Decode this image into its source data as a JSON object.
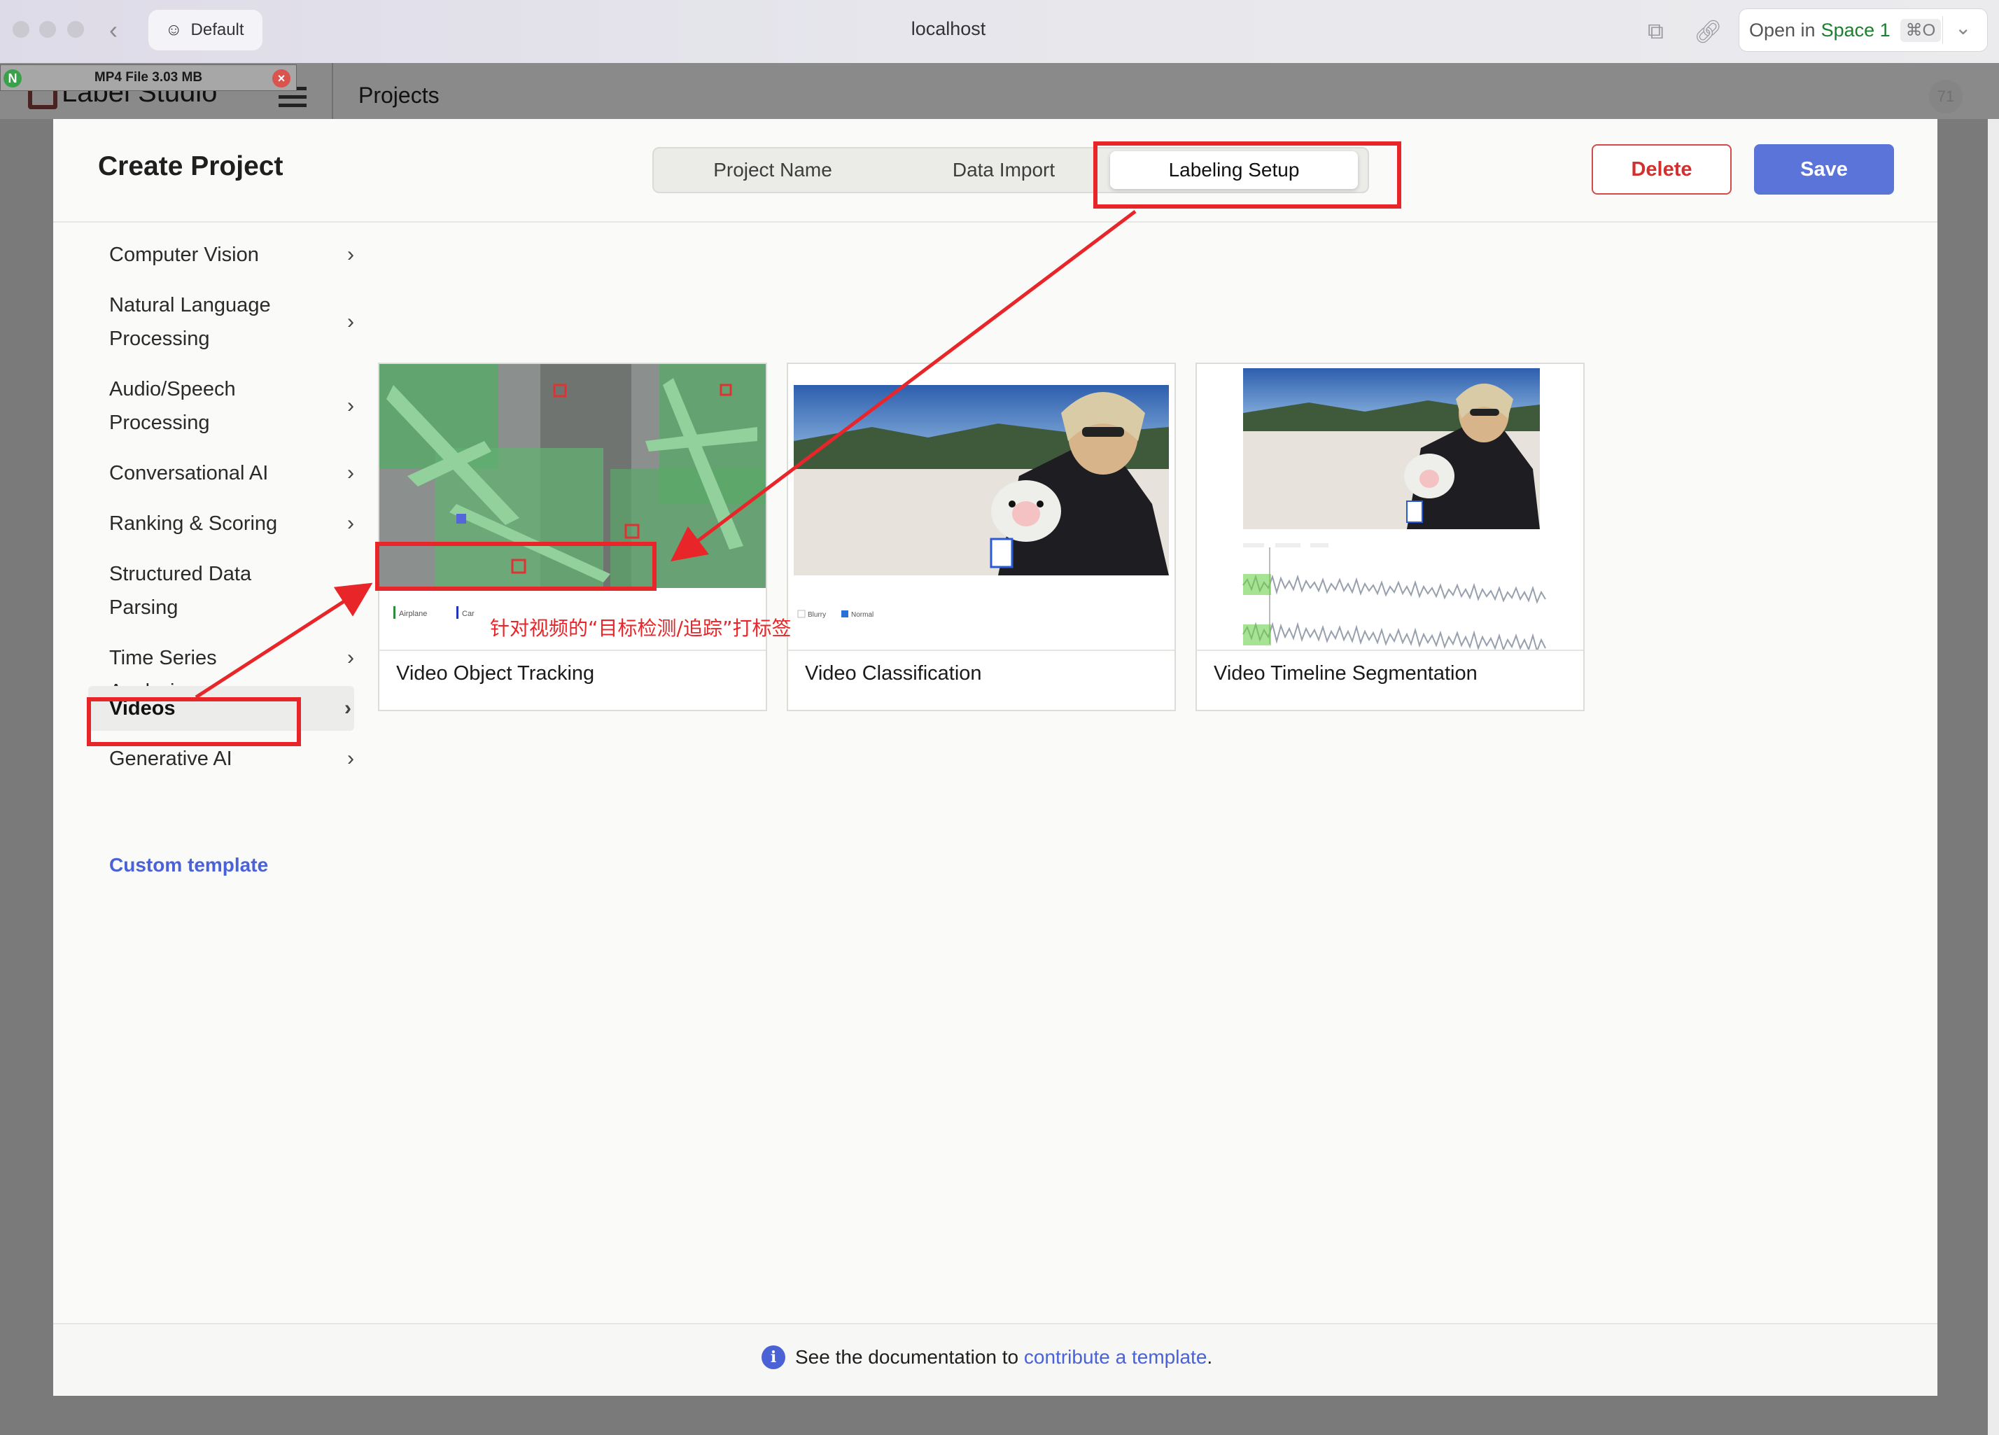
{
  "browser": {
    "profile_label": "Default",
    "url": "localhost",
    "open_in_label": "Open in",
    "open_in_space": "Space 1",
    "open_in_shortcut": "⌘O"
  },
  "app": {
    "name": "Label Studio",
    "section": "Projects",
    "badge": "71",
    "file_chip": "MP4 File 3.03 MB"
  },
  "modal": {
    "title": "Create Project",
    "tabs": [
      {
        "label": "Project Name"
      },
      {
        "label": "Data Import"
      },
      {
        "label": "Labeling Setup"
      }
    ],
    "active_tab": "Labeling Setup",
    "delete_label": "Delete",
    "save_label": "Save"
  },
  "sidebar": {
    "items": [
      {
        "label": "Computer Vision"
      },
      {
        "label": "Natural Language Processing"
      },
      {
        "label": "Audio/Speech Processing"
      },
      {
        "label": "Conversational AI"
      },
      {
        "label": "Ranking & Scoring"
      },
      {
        "label": "Structured Data Parsing"
      },
      {
        "label": "Time Series Analysis"
      },
      {
        "label": "Videos"
      },
      {
        "label": "Generative AI"
      }
    ],
    "selected": "Videos",
    "custom_template": "Custom template"
  },
  "templates": [
    {
      "title": "Video Object Tracking",
      "thumb_labels": [
        "Airplane",
        "Car"
      ]
    },
    {
      "title": "Video Classification",
      "thumb_labels": [
        "Blurry",
        "Normal"
      ]
    },
    {
      "title": "Video Timeline Segmentation"
    }
  ],
  "footer": {
    "prefix": "See the documentation to",
    "link": "contribute a template",
    "suffix": "."
  },
  "annotation": {
    "note": "针对视频的“目标检测/追踪”打标签"
  },
  "colors": {
    "accent": "#5b74d9",
    "danger": "#d32f2f",
    "annotation": "#e8262a",
    "link": "#4a62d6"
  }
}
